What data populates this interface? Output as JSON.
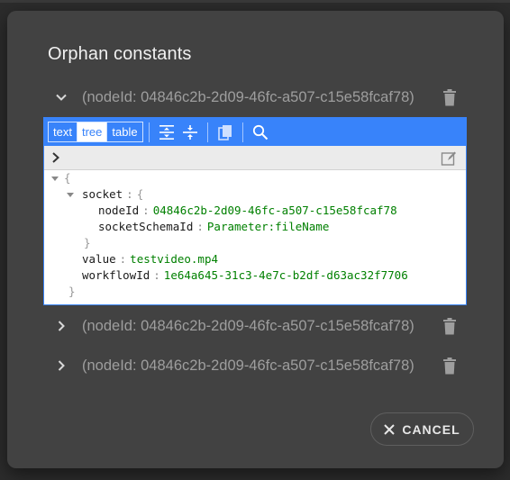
{
  "dialog": {
    "title": "Orphan constants",
    "cancel_label": "CANCEL"
  },
  "constants": [
    {
      "label": "(nodeId: 04846c2b-2d09-46fc-a507-c15e58fcaf78)",
      "expanded": true
    },
    {
      "label": "(nodeId: 04846c2b-2d09-46fc-a507-c15e58fcaf78)",
      "expanded": false
    },
    {
      "label": "(nodeId: 04846c2b-2d09-46fc-a507-c15e58fcaf78)",
      "expanded": false
    }
  ],
  "editor": {
    "modes": [
      "text",
      "tree",
      "table"
    ],
    "active_mode": "tree",
    "tree": {
      "open_brace": "{",
      "close_brace": "}",
      "socket_key": "socket",
      "socket_open": "{",
      "socket_close": "}",
      "node_id_key": "nodeId",
      "node_id_value": "04846c2b-2d09-46fc-a507-c15e58fcaf78",
      "schema_key": "socketSchemaId",
      "schema_value": "Parameter:fileName",
      "value_key": "value",
      "value_value": "testvideo.mp4",
      "workflow_key": "workflowId",
      "workflow_value": "1e64a645-31c3-4e7c-b2df-d63ac32f7706",
      "separator": ":"
    }
  },
  "icons": {
    "row_expand": "chevron-icon",
    "row_delete": "trash-icon",
    "expand_all": "expand-all-icon",
    "collapse_all": "collapse-all-icon",
    "copy": "copy-icon",
    "search": "search-icon",
    "nav_expand": "chevron-right-icon",
    "edit": "pencil-icon"
  },
  "colors": {
    "dialog_bg": "#424242",
    "accent_blue": "#3883fa",
    "string_value": "#008000"
  }
}
